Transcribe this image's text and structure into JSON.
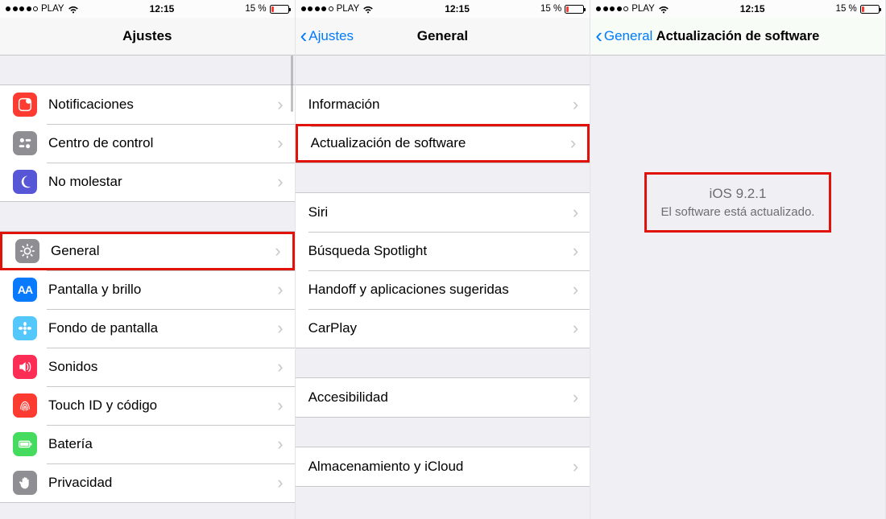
{
  "status": {
    "carrier": "PLAY",
    "time": "12:15",
    "battery_percent": "15 %",
    "battery_fill_percent": 15,
    "signal_filled": 4,
    "signal_total": 5
  },
  "screen1": {
    "title": "Ajustes",
    "group1": [
      {
        "key": "notificaciones",
        "label": "Notificaciones",
        "icon": "ic-notif",
        "icon_name": "notifications-icon",
        "glyph": "notif"
      },
      {
        "key": "centro-de-control",
        "label": "Centro de control",
        "icon": "ic-control",
        "icon_name": "control-center-icon",
        "glyph": "control"
      },
      {
        "key": "no-molestar",
        "label": "No molestar",
        "icon": "ic-dnd",
        "icon_name": "do-not-disturb-icon",
        "glyph": "moon"
      }
    ],
    "group2": [
      {
        "key": "general",
        "label": "General",
        "icon": "ic-general",
        "icon_name": "gear-icon",
        "glyph": "gear",
        "highlight": true
      },
      {
        "key": "pantalla-brillo",
        "label": "Pantalla y brillo",
        "icon": "ic-display",
        "icon_name": "display-icon",
        "glyph": "aa"
      },
      {
        "key": "fondo-pantalla",
        "label": "Fondo de pantalla",
        "icon": "ic-wall",
        "icon_name": "wallpaper-icon",
        "glyph": "flower"
      },
      {
        "key": "sonidos",
        "label": "Sonidos",
        "icon": "ic-sounds",
        "icon_name": "sounds-icon",
        "glyph": "speaker"
      },
      {
        "key": "touch-id",
        "label": "Touch ID y código",
        "icon": "ic-touchid",
        "icon_name": "fingerprint-icon",
        "glyph": "finger"
      },
      {
        "key": "bateria",
        "label": "Batería",
        "icon": "ic-battery",
        "icon_name": "battery-icon",
        "glyph": "battery"
      },
      {
        "key": "privacidad",
        "label": "Privacidad",
        "icon": "ic-privacy",
        "icon_name": "privacy-hand-icon",
        "glyph": "hand"
      }
    ]
  },
  "screen2": {
    "back_label": "Ajustes",
    "title": "General",
    "group1": [
      {
        "key": "informacion",
        "label": "Información"
      },
      {
        "key": "actualizacion-software",
        "label": "Actualización de software",
        "highlight": true
      }
    ],
    "group2": [
      {
        "key": "siri",
        "label": "Siri"
      },
      {
        "key": "spotlight",
        "label": "Búsqueda Spotlight"
      },
      {
        "key": "handoff",
        "label": "Handoff y aplicaciones sugeridas"
      },
      {
        "key": "carplay",
        "label": "CarPlay"
      }
    ],
    "group3": [
      {
        "key": "accesibilidad",
        "label": "Accesibilidad"
      }
    ],
    "group4": [
      {
        "key": "almacenamiento",
        "label": "Almacenamiento y iCloud"
      }
    ]
  },
  "screen3": {
    "back_label": "General",
    "title": "Actualización de software",
    "version": "iOS 9.2.1",
    "message": "El software está actualizado."
  }
}
